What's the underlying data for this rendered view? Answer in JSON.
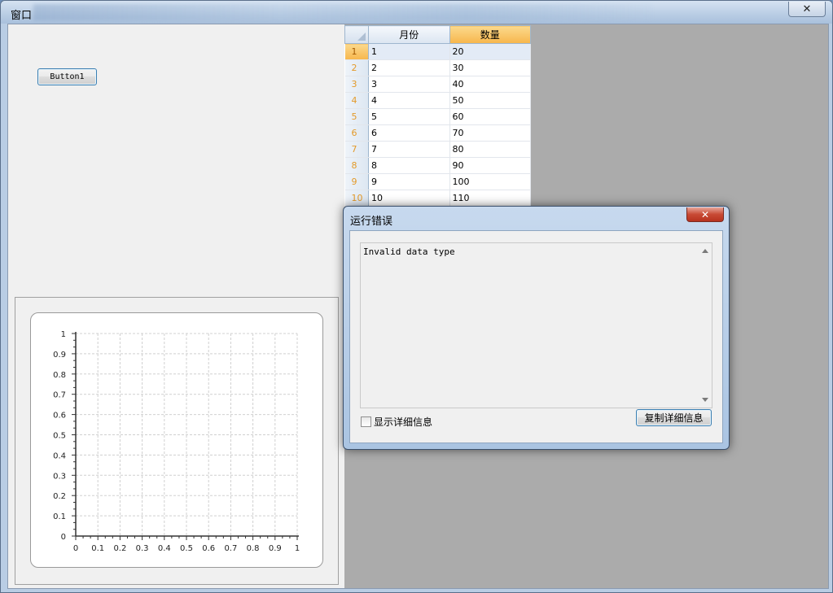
{
  "window": {
    "title": "窗口",
    "close_glyph": "✕"
  },
  "form": {
    "button1_label": "Button1"
  },
  "table": {
    "columns": [
      "月份",
      "数量"
    ],
    "rows": [
      {
        "num": "1",
        "month": "1",
        "qty": "20"
      },
      {
        "num": "2",
        "month": "2",
        "qty": "30"
      },
      {
        "num": "3",
        "month": "3",
        "qty": "40"
      },
      {
        "num": "4",
        "month": "4",
        "qty": "50"
      },
      {
        "num": "5",
        "month": "5",
        "qty": "60"
      },
      {
        "num": "6",
        "month": "6",
        "qty": "70"
      },
      {
        "num": "7",
        "month": "7",
        "qty": "80"
      },
      {
        "num": "8",
        "month": "8",
        "qty": "90"
      },
      {
        "num": "9",
        "month": "9",
        "qty": "100"
      },
      {
        "num": "10",
        "month": "10",
        "qty": "110"
      }
    ],
    "selected_row": 1,
    "selected_column": "数量"
  },
  "chart_data": {
    "type": "scatter",
    "title": "",
    "xlabel": "",
    "ylabel": "",
    "xlim": [
      0,
      1
    ],
    "ylim": [
      0,
      1
    ],
    "x_ticks": [
      "0",
      "0.1",
      "0.2",
      "0.3",
      "0.4",
      "0.5",
      "0.6",
      "0.7",
      "0.8",
      "0.9",
      "1"
    ],
    "y_ticks": [
      "0",
      "0.1",
      "0.2",
      "0.3",
      "0.4",
      "0.5",
      "0.6",
      "0.7",
      "0.8",
      "0.9",
      "1"
    ],
    "grid": true,
    "series": []
  },
  "dialog": {
    "title": "运行错误",
    "close_glyph": "✕",
    "message": "Invalid data type",
    "show_details_label": "显示详细信息",
    "show_details_checked": false,
    "copy_button_label": "复制详细信息"
  },
  "colors": {
    "selection_orange": "#f7b64c",
    "dialog_close_red": "#c84a35",
    "button_border": "#3c7fb1"
  }
}
